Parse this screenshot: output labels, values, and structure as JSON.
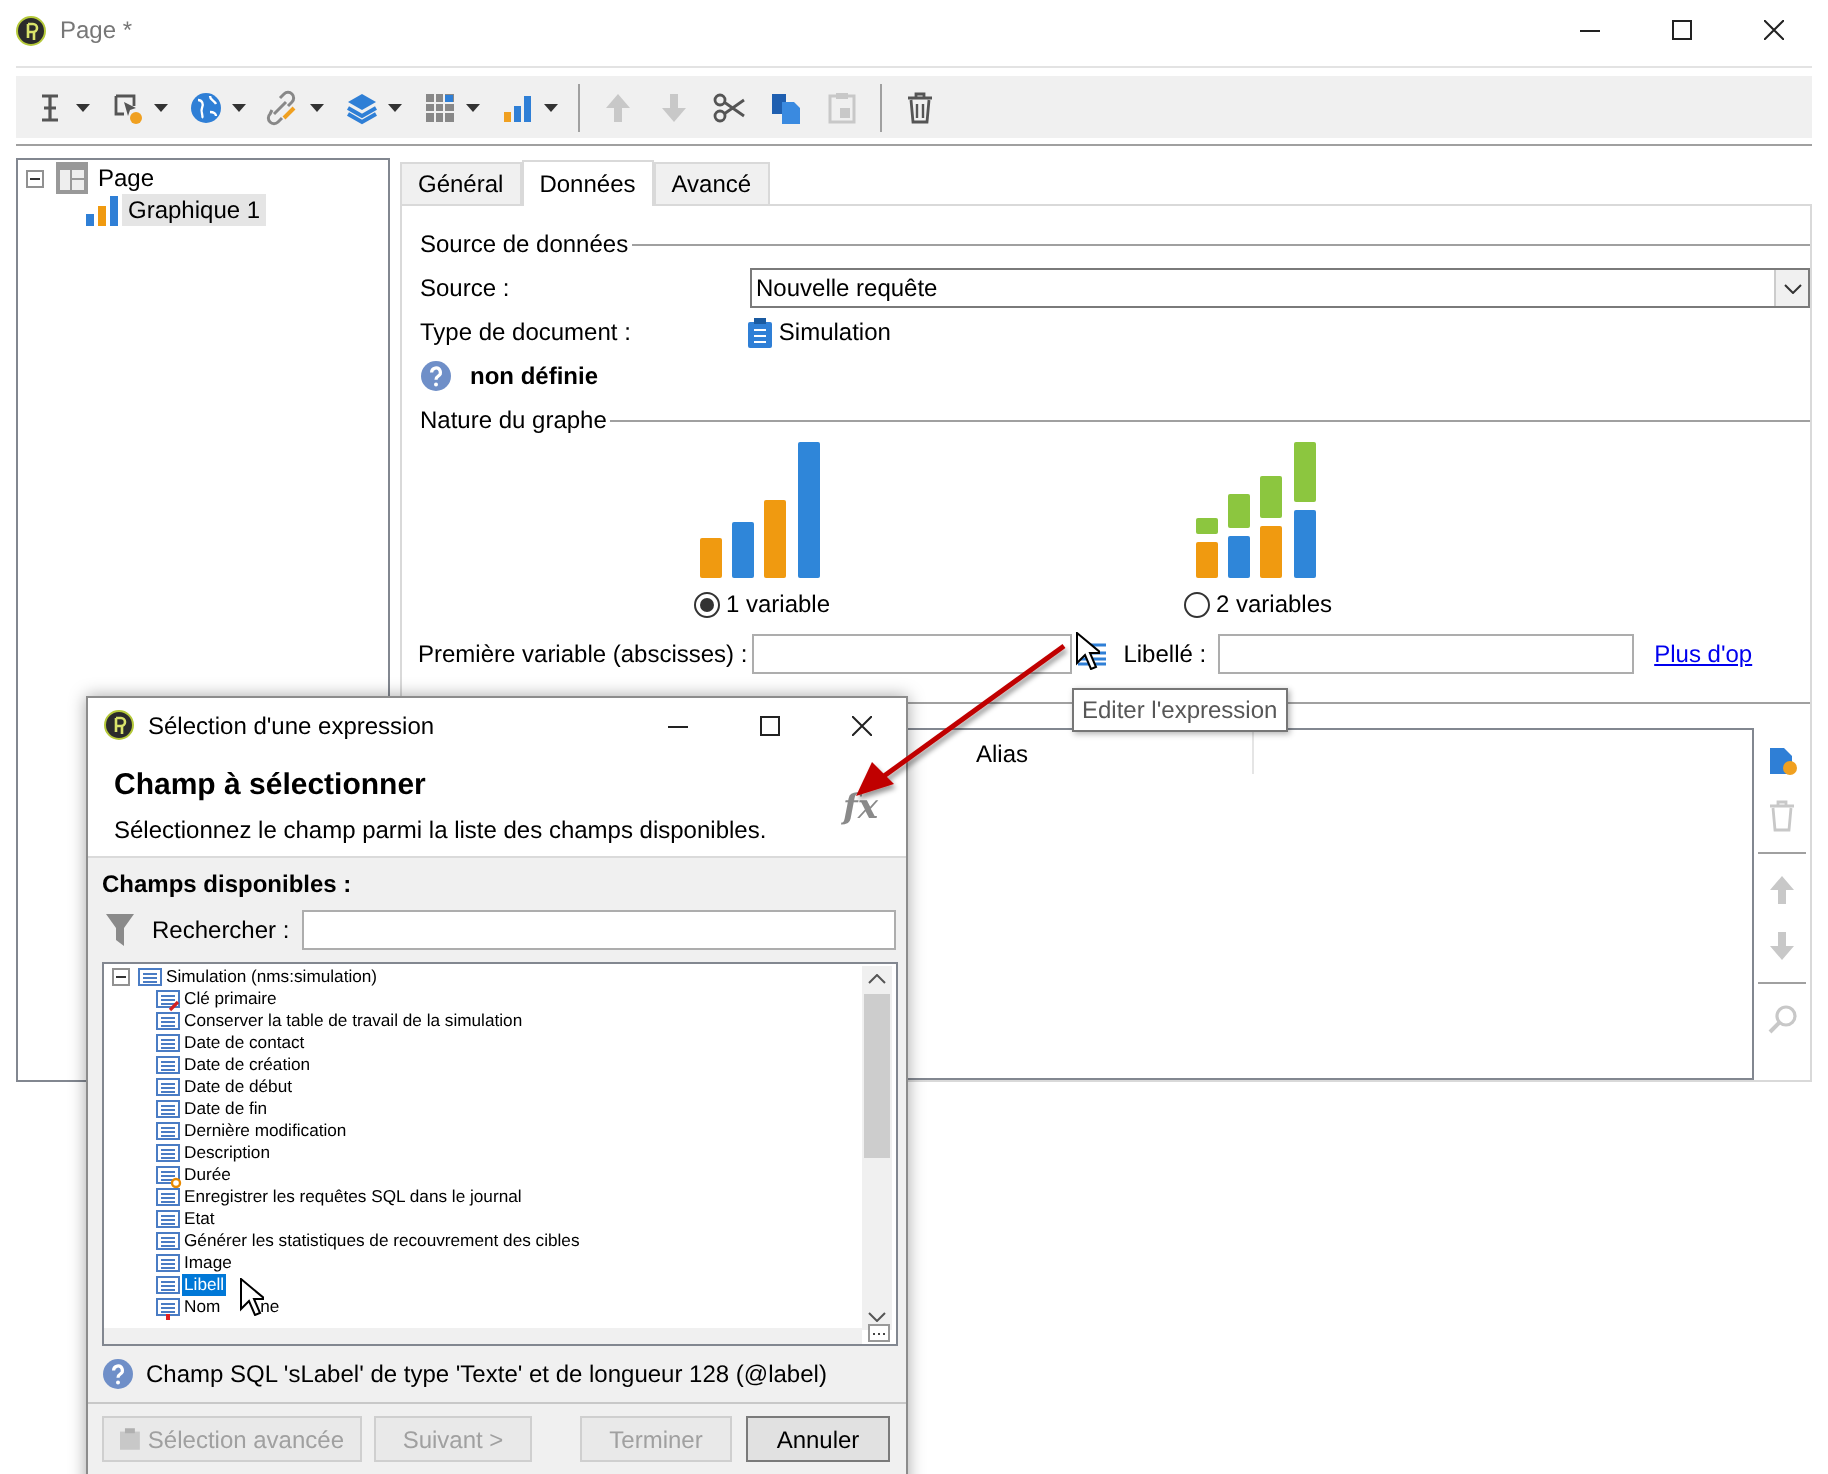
{
  "window": {
    "title": "Page *"
  },
  "toolbar": [
    {
      "kind": "button",
      "dropdown": true,
      "disabled": false
    },
    {
      "kind": "button",
      "dropdown": true,
      "disabled": false
    },
    {
      "kind": "button",
      "dropdown": true,
      "disabled": false
    },
    {
      "kind": "button",
      "dropdown": true,
      "disabled": false
    },
    {
      "kind": "button",
      "dropdown": true,
      "disabled": false
    },
    {
      "kind": "button",
      "dropdown": true,
      "disabled": false
    },
    {
      "kind": "button",
      "dropdown": true,
      "disabled": false
    },
    {
      "kind": "separator"
    },
    {
      "kind": "button",
      "dropdown": false,
      "disabled": true
    },
    {
      "kind": "button",
      "dropdown": false,
      "disabled": true
    },
    {
      "kind": "button",
      "dropdown": false,
      "disabled": false
    },
    {
      "kind": "button",
      "dropdown": false,
      "disabled": false
    },
    {
      "kind": "button",
      "dropdown": false,
      "disabled": true
    },
    {
      "kind": "separator"
    },
    {
      "kind": "button",
      "dropdown": false,
      "disabled": false
    }
  ],
  "tree": [
    {
      "label": "Page",
      "kind": "page",
      "expanded": true,
      "selected": false,
      "children": [
        {
          "label": "Graphique 1",
          "kind": "chart",
          "selected": true
        }
      ]
    }
  ],
  "tabs": [
    {
      "label": "Général",
      "selected": false
    },
    {
      "label": "Données",
      "selected": true
    },
    {
      "label": "Avancé",
      "selected": false
    }
  ],
  "data_source": {
    "section": "Source de données",
    "source_label": "Source :",
    "source_value": "Nouvelle requête",
    "doc_type_label": "Type de document :",
    "doc_type_value": "Simulation",
    "status": "non définie"
  },
  "graph_nature": {
    "section": "Nature du graphe",
    "options": [
      {
        "label": "1 variable",
        "kind": "single",
        "selected": true
      },
      {
        "label": "2 variables",
        "kind": "double",
        "selected": false
      }
    ]
  },
  "first_variable": {
    "label": "Première variable (abscisses) :",
    "value_label": "Libellé :",
    "link": "Plus d'op",
    "tooltip": "Editer l'expression"
  },
  "table": {
    "columns": [
      "Alias"
    ]
  },
  "side_buttons": [
    {
      "kind": "add",
      "disabled": false
    },
    {
      "kind": "delete",
      "disabled": true
    },
    {
      "kind": "separator"
    },
    {
      "kind": "up",
      "disabled": true
    },
    {
      "kind": "down",
      "disabled": true
    },
    {
      "kind": "separator"
    },
    {
      "kind": "search",
      "disabled": true
    }
  ],
  "dialog": {
    "title": "Sélection d'une expression",
    "heading": "Champ à sélectionner",
    "subtitle": "Sélectionnez le champ parmi la liste des champs disponibles.",
    "function_symbol": "fx",
    "fields_label": "Champs disponibles :",
    "search_label": "Rechercher :",
    "tree": {
      "label": "Simulation (nms:simulation)",
      "expanded": true,
      "children": [
        {
          "label": "Clé primaire",
          "kind": "key",
          "selected": false
        },
        {
          "label": "Conserver la table de travail de la simulation",
          "kind": "field",
          "selected": false
        },
        {
          "label": "Date de contact",
          "kind": "field",
          "selected": false
        },
        {
          "label": "Date de création",
          "kind": "field",
          "selected": false
        },
        {
          "label": "Date de début",
          "kind": "field",
          "selected": false
        },
        {
          "label": "Date de fin",
          "kind": "field",
          "selected": false
        },
        {
          "label": "Dernière modification",
          "kind": "field",
          "selected": false
        },
        {
          "label": "Description",
          "kind": "field",
          "selected": false
        },
        {
          "label": "Durée",
          "kind": "computed",
          "selected": false
        },
        {
          "label": "Enregistrer les requêtes SQL dans le journal",
          "kind": "field",
          "selected": false
        },
        {
          "label": "Etat",
          "kind": "field",
          "selected": false
        },
        {
          "label": "Générer les statistiques de recouvrement des cibles",
          "kind": "field",
          "selected": false
        },
        {
          "label": "Image",
          "kind": "field",
          "selected": false
        },
        {
          "label": "Libell",
          "kind": "field",
          "selected": true
        },
        {
          "label": "Nom",
          "label_end": "ne",
          "kind": "mandatory",
          "selected": false
        }
      ]
    },
    "status": "Champ SQL 'sLabel' de type 'Texte' et de longueur 128 (@label)",
    "buttons": [
      {
        "label": "Sélection avancée",
        "kind": "advanced",
        "disabled": true
      },
      {
        "label": "Suivant >",
        "kind": "next",
        "disabled": true
      },
      {
        "label": "Terminer",
        "kind": "finish",
        "disabled": true
      },
      {
        "label": "Annuler",
        "kind": "cancel",
        "disabled": false
      }
    ]
  }
}
